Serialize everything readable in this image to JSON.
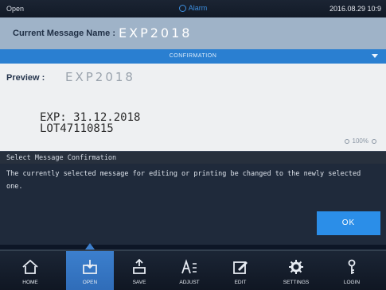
{
  "status": {
    "mode": "Open",
    "alarm": "Alarm",
    "datetime": "2016.08.29 10:9"
  },
  "message": {
    "name_label": "Current Message Name :",
    "name_value": "EXP2018"
  },
  "confirmation_bar": {
    "label": "CONFIRMATION"
  },
  "preview": {
    "label": "Preview :",
    "name": "EXP2018",
    "line1": "EXP: 31.12.2018",
    "line2": "LOT47110815",
    "zoom": "100%"
  },
  "dialog": {
    "title": "Select Message Confirmation",
    "message": "The currently selected message for editing or printing be changed to the newly selected one.",
    "ok_label": "OK"
  },
  "nav": {
    "items": [
      {
        "label": "HOME",
        "icon": "home-icon"
      },
      {
        "label": "OPEN",
        "icon": "open-icon",
        "active": true
      },
      {
        "label": "SAVE",
        "icon": "save-icon"
      },
      {
        "label": "ADJUST",
        "icon": "adjust-icon"
      },
      {
        "label": "EDIT",
        "icon": "edit-icon"
      },
      {
        "label": "SETTINGS",
        "icon": "settings-icon"
      },
      {
        "label": "LOGIN",
        "icon": "login-icon"
      }
    ]
  },
  "colors": {
    "accent": "#2a7fd1",
    "ok_button": "#2b8ee8",
    "header_bg": "#9fb3c8"
  }
}
